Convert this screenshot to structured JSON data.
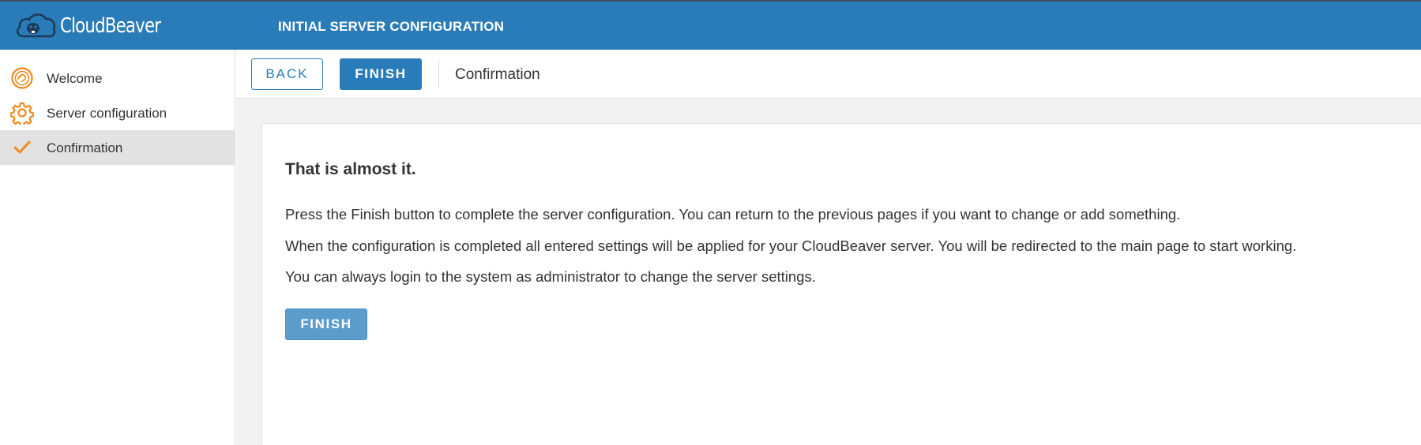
{
  "header": {
    "logo_text": "CloudBeaver",
    "logo_icon": "beaver-cloud-icon",
    "title": "INITIAL SERVER CONFIGURATION"
  },
  "sidebar": {
    "items": [
      {
        "label": "Welcome",
        "icon": "welcome-icon",
        "active": false
      },
      {
        "label": "Server configuration",
        "icon": "gear-icon",
        "active": false
      },
      {
        "label": "Confirmation",
        "icon": "checkmark-icon",
        "active": true
      }
    ]
  },
  "toolbar": {
    "back_label": "BACK",
    "finish_label": "FINISH",
    "title": "Confirmation"
  },
  "main": {
    "heading": "That is almost it.",
    "paragraphs": [
      "Press the Finish button to complete the server configuration. You can return to the previous pages if you want to change or add something.",
      "When the configuration is completed all entered settings will be applied for your CloudBeaver server. You will be redirected to the main page to start working.",
      "You can always login to the system as administrator to change the server settings."
    ],
    "finish_label": "FINISH"
  },
  "colors": {
    "header_bg": "#2a7cb8",
    "accent_orange": "#f08a1c",
    "active_item_bg": "#e2e2e2",
    "primary_button": "#2a7cb8",
    "secondary_button": "#5a9dcc"
  }
}
